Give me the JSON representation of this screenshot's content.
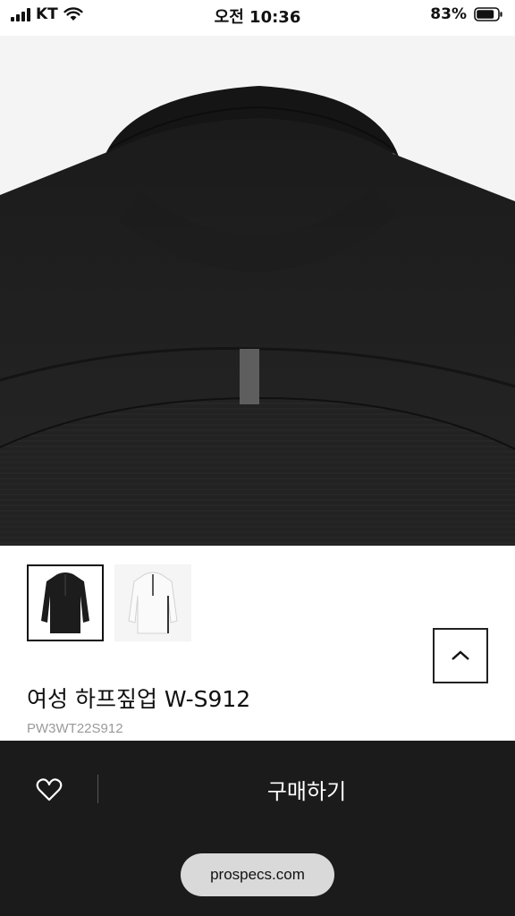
{
  "status_bar": {
    "carrier": "KT",
    "time": "오전 10:36",
    "battery_percent": "83%"
  },
  "product": {
    "title": "여성 하프짚업 W-S912",
    "code": "PW3WT22S912",
    "thumbnails": [
      {
        "label": "black-shirt-thumbnail",
        "selected": true
      },
      {
        "label": "white-shirt-thumbnail",
        "selected": false
      }
    ]
  },
  "bottom_bar": {
    "buy_label": "구매하기",
    "url": "prospecs.com"
  },
  "icons": {
    "wishlist": "heart-icon",
    "scroll_top": "chevron-up-icon"
  },
  "colors": {
    "bottom_bar": "#1b1b1b",
    "hero_background": "#f4f4f4",
    "shirt": "#1e1e1e",
    "reflective_tab": "#5e5e5e"
  }
}
